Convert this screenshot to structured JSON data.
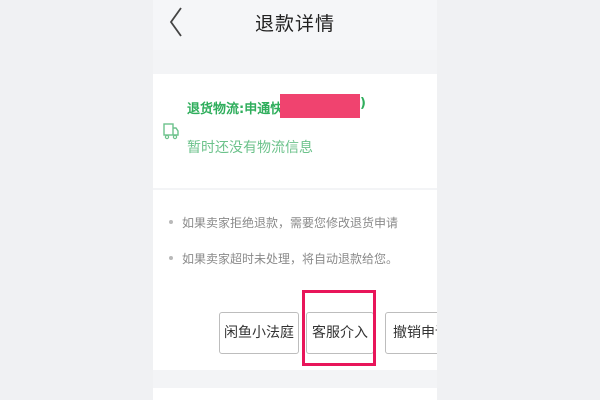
{
  "header": {
    "title": "退款详情"
  },
  "logistics": {
    "title": "退货物流:申通快递(",
    "title_close": ")",
    "status": "暂时还没有物流信息"
  },
  "tips": [
    "如果卖家拒绝退款，需要您修改退货申请",
    "如果卖家超时未处理，将自动退款给您。"
  ],
  "actions": {
    "court_label": "闲鱼小法庭",
    "service_label": "客服介入",
    "cancel_label": "撤销申请"
  },
  "colors": {
    "accent_green": "#2fae5c",
    "highlight_red": "#e8155a",
    "redaction_pink": "#f0436f"
  },
  "icons": {
    "back": "chevron-left-icon",
    "logistics": "truck-icon"
  }
}
